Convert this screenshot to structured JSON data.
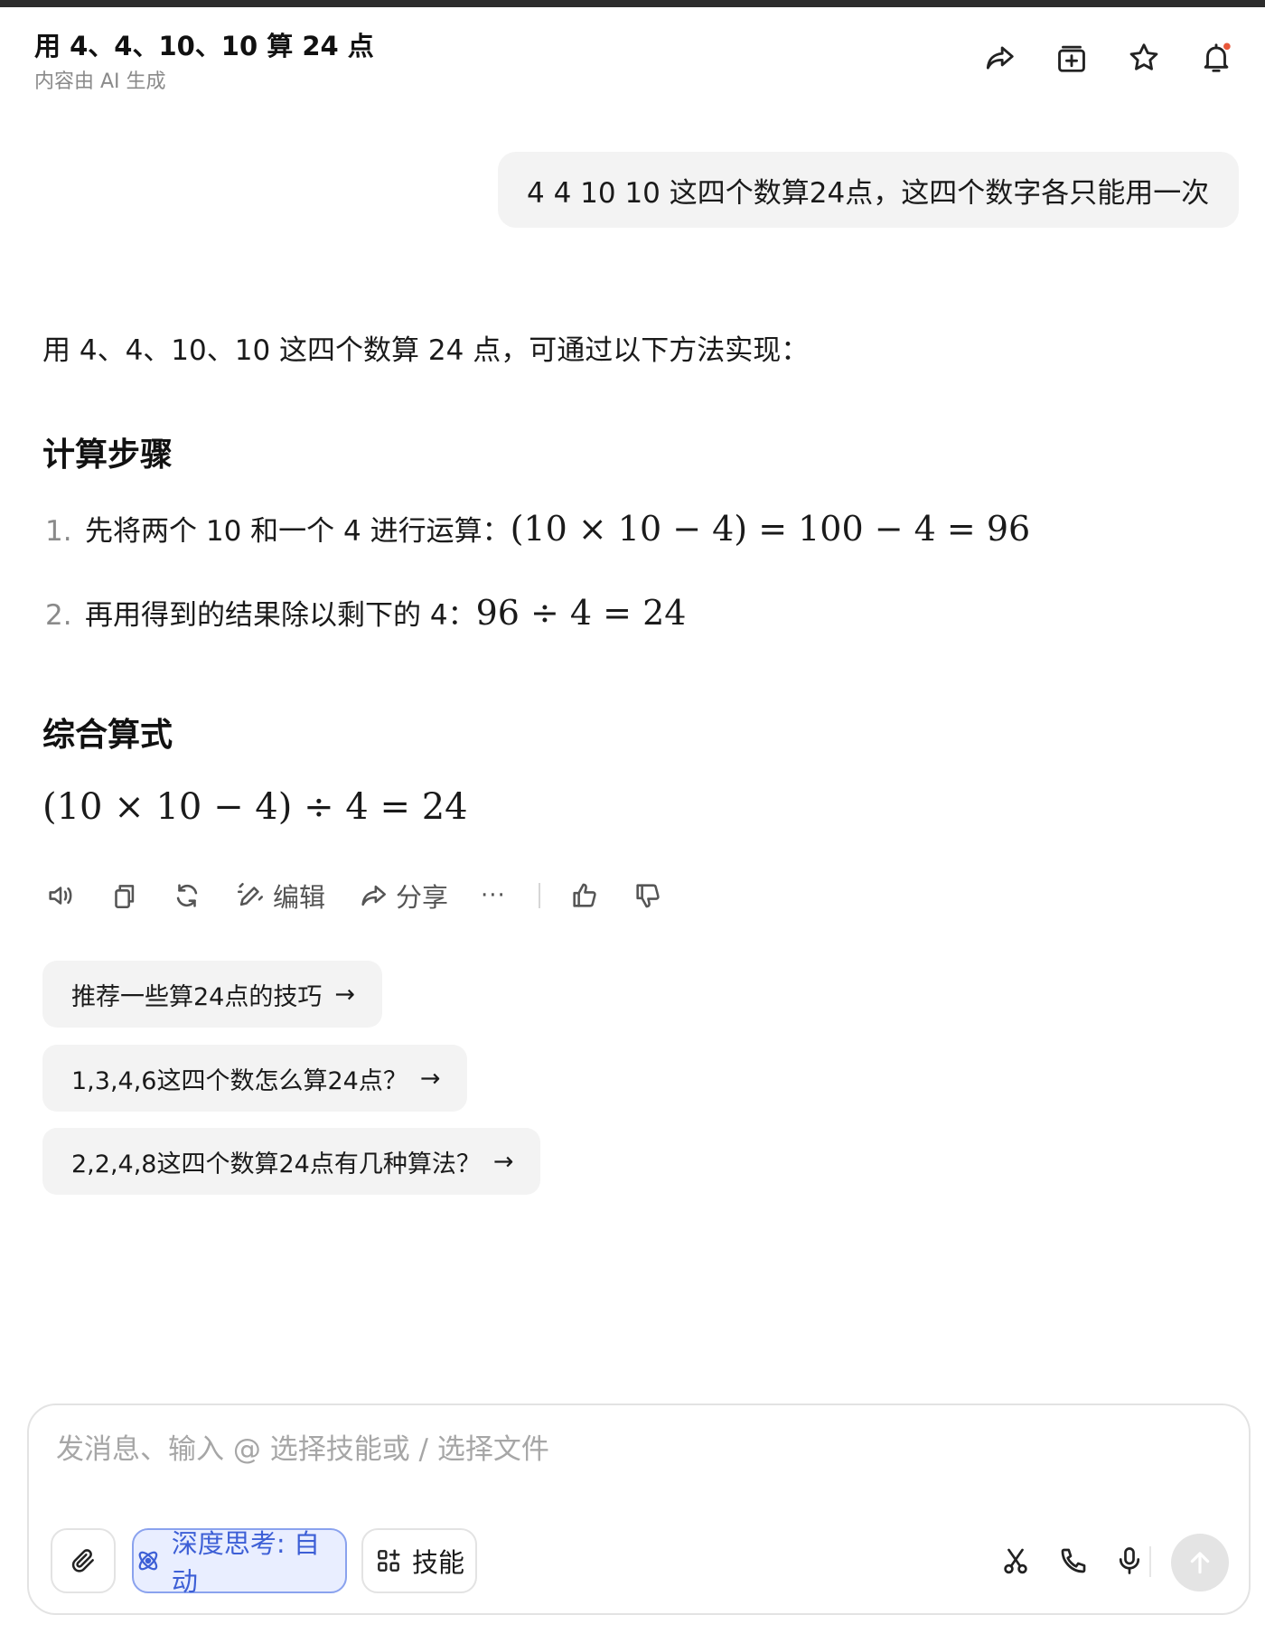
{
  "header": {
    "title": "用 4、4、10、10 算 24 点",
    "subtitle": "内容由 AI 生成",
    "icons": [
      "share-icon",
      "add-to-collection-icon",
      "star-icon",
      "bell-icon"
    ],
    "notification_dot_color": "#e8573a"
  },
  "user_message": "4 4 10 10 这四个数算24点，这四个数字各只能用一次",
  "answer": {
    "intro": "用 4、4、10、10 这四个数算 24 点，可通过以下方法实现：",
    "section1_title": "计算步骤",
    "steps": [
      {
        "num": "1.",
        "text": "先将两个 10 和一个 4 进行运算：",
        "math": "(10 × 10 − 4) = 100 − 4 = 96"
      },
      {
        "num": "2.",
        "text": "再用得到的结果除以剩下的 4：",
        "math": "96 ÷ 4 = 24"
      }
    ],
    "section2_title": "综合算式",
    "formula": "(10 × 10 − 4) ÷ 4 = 24"
  },
  "actions": {
    "edit_label": "编辑",
    "share_label": "分享",
    "more_label": "···",
    "icons": [
      "speaker-icon",
      "copy-icon",
      "regenerate-icon",
      "edit-icon",
      "share-icon",
      "more-icon",
      "thumbs-up-icon",
      "thumbs-down-icon"
    ]
  },
  "suggestions": [
    {
      "text": "推荐一些算24点的技巧",
      "arrow": "→"
    },
    {
      "text": "1,3,4,6这四个数怎么算24点？",
      "arrow": "→"
    },
    {
      "text": "2,2,4,8这四个数算24点有几种算法？",
      "arrow": "→"
    }
  ],
  "composer": {
    "placeholder": "发消息、输入 @ 选择技能或 / 选择文件",
    "deep_think_label": "深度思考: 自动",
    "skills_label": "技能",
    "accent_color": "#3d5fd6"
  }
}
